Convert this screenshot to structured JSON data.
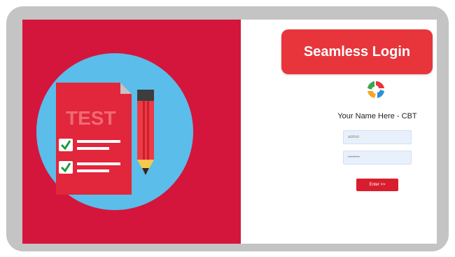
{
  "badge": {
    "label": "Seamless Login"
  },
  "site": {
    "title": "Your Name Here - CBT"
  },
  "login": {
    "username_placeholder": "admin",
    "password_placeholder": "••••••••",
    "enter_label": "Enter >>"
  },
  "illustration": {
    "label": "TEST"
  },
  "colors": {
    "panel_red": "#d4163c",
    "badge_red": "#e8353b",
    "circle_blue": "#5bbdea",
    "check_green": "#1f9a3c",
    "field_blue": "#e8f0fc"
  }
}
